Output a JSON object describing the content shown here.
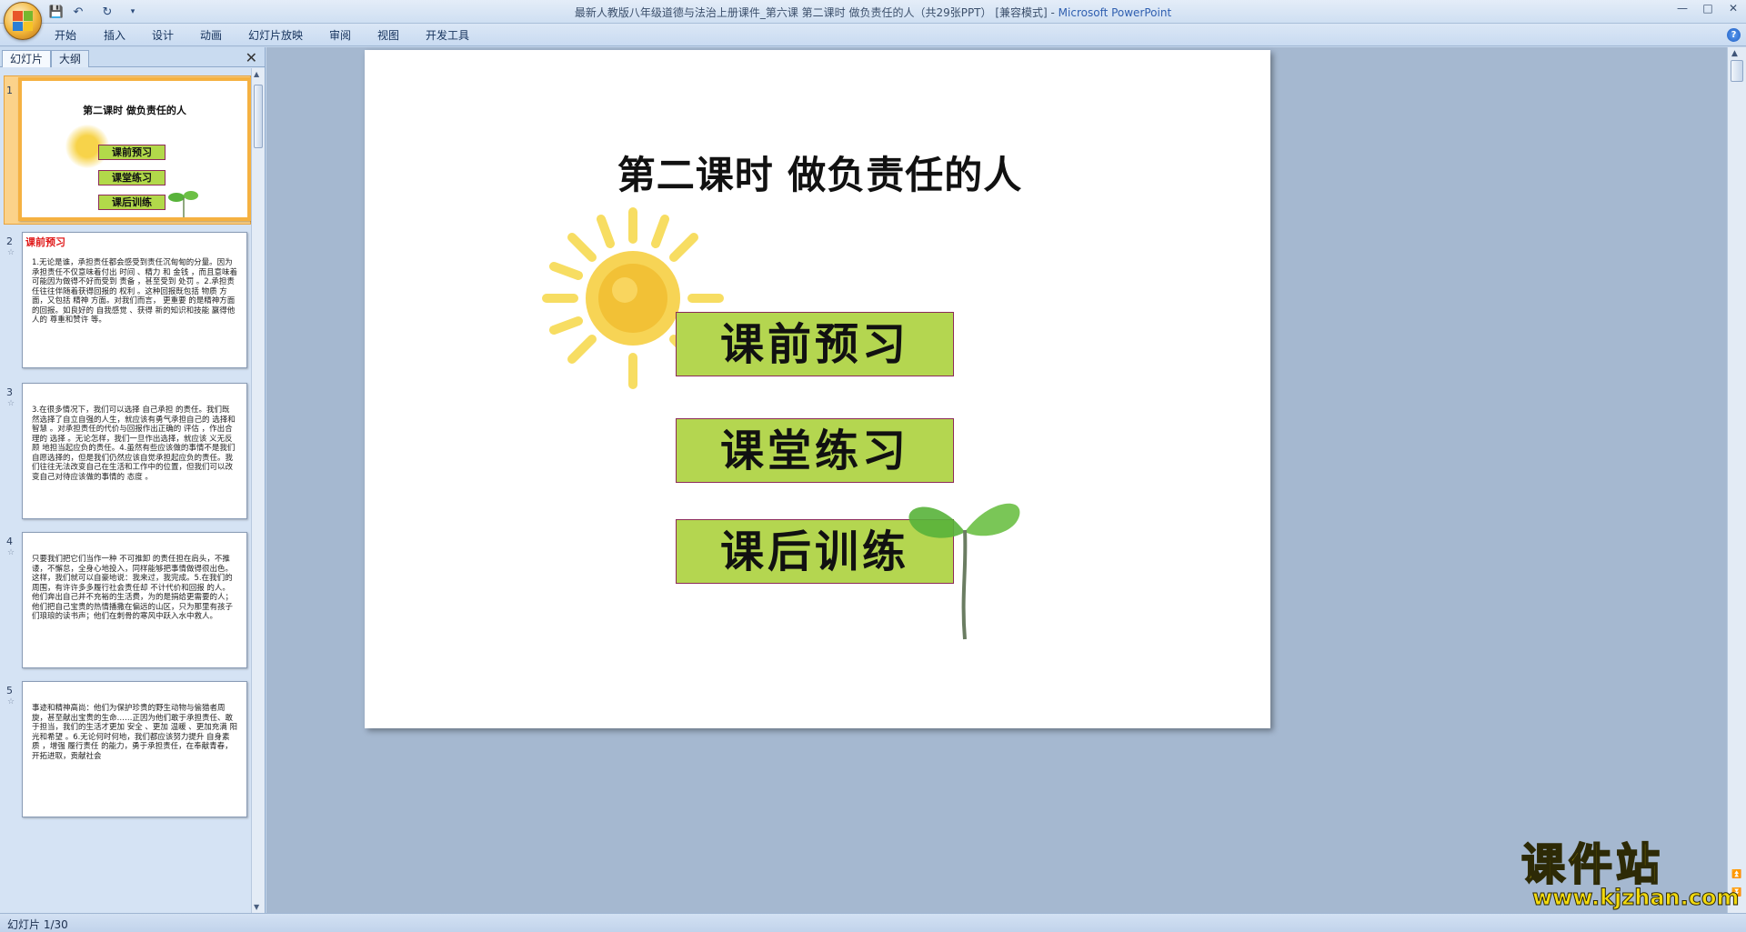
{
  "window": {
    "title": "最新人教版八年级道德与法治上册课件_第六课 第二课时  做负责任的人（共29张PPT） [兼容模式]",
    "app_name": "Microsoft PowerPoint",
    "minimize": "—",
    "maximize": "□",
    "close": "✕"
  },
  "quick_access": {
    "save": "💾",
    "undo": "↶",
    "redo": "↻",
    "more": "▾"
  },
  "ribbon": {
    "tabs": [
      "开始",
      "插入",
      "设计",
      "动画",
      "幻灯片放映",
      "审阅",
      "视图",
      "开发工具"
    ],
    "help": "?"
  },
  "pane": {
    "tabs": [
      "幻灯片",
      "大纲"
    ],
    "close": "✕"
  },
  "thumbnails": [
    {
      "num": "1",
      "title": "第二课时  做负责任的人",
      "buttons": [
        "课前预习",
        "课堂练习",
        "课后训练"
      ]
    },
    {
      "num": "2",
      "star": "☆",
      "heading": "课前预习",
      "text": "1.无论是谁，承担责任都会感受到责任沉甸甸的分量。因为承担责任不仅意味着付出 时间 、精力 和 金钱 ，而且意味着可能因为做得不好而受到 责备 ，甚至受到 处罚 。2.承担责任往往伴随着获得回报的 权利 。这种回报既包括 物质 方面，又包括 精神 方面。对我们而言， 更重要 的是精神方面的回报。如良好的 自我感觉 、获得 新的知识和技能 赢得他人的 尊重和赞许 等。"
    },
    {
      "num": "3",
      "star": "☆",
      "text": "3.在很多情况下，我们可以选择 自己承担 的责任。我们既然选择了自立自强的人生，就应该有勇气承担自己的 选择和智慧 。对承担责任的代价与回报作出正确的 评估 ，作出合理的 选择 。无论怎样，我们一旦作出选择，就应该 义无反顾 地担当起应负的责任。4.虽然有些应该做的事情不是我们自愿选择的，但是我们仍然应该自觉承担起应负的责任。我们往往无法改变自己在生活和工作中的位置，但我们可以改变自己对待应该做的事情的 态度 。"
    },
    {
      "num": "4",
      "star": "☆",
      "text": "只要我们把它们当作一种 不可推卸 的责任担在肩头，不推诿，不懈怠，全身心地投入，同样能够把事情做得很出色。这样，我们就可以自豪地说：我来过，我完成。5.在我们的周围，有许许多多履行社会责任却 不计代价和回报 的人。他们奔出自己并不充裕的生活费，为的是捐给更需要的人；他们把自己宝贵的热情播撒在偏远的山区，只为那里有孩子们琅琅的读书声；他们在刺骨的寒风中跃入水中救人。"
    },
    {
      "num": "5",
      "star": "☆",
      "text": "事迹和精神高尚：他们为保护珍贵的野生动物与偷猎者周旋，甚至献出宝贵的生命……正因为他们敢于承担责任、敢于担当，我们的生活才更加 安全 、更加 温暖 、更加充满 阳光和希望 。6.无论何时何地，我们都应该努力提升 自身素质 ，增强 履行责任 的能力，勇于承担责任，在奉献青春，开拓进取，贡献社会"
    }
  ],
  "slide": {
    "title": "第二课时  做负责任的人",
    "buttons": [
      "课前预习",
      "课堂练习",
      "课后训练"
    ]
  },
  "status": {
    "text": "幻灯片 1/30"
  },
  "watermark": {
    "main": "课件站",
    "url": "www.kjzhan.com"
  },
  "colors": {
    "button_fill": "#b4d650",
    "button_border": "#8c2b5a",
    "highlight_red": "#e01818",
    "sun": "#f7d34a",
    "leaf": "#58b33a"
  }
}
